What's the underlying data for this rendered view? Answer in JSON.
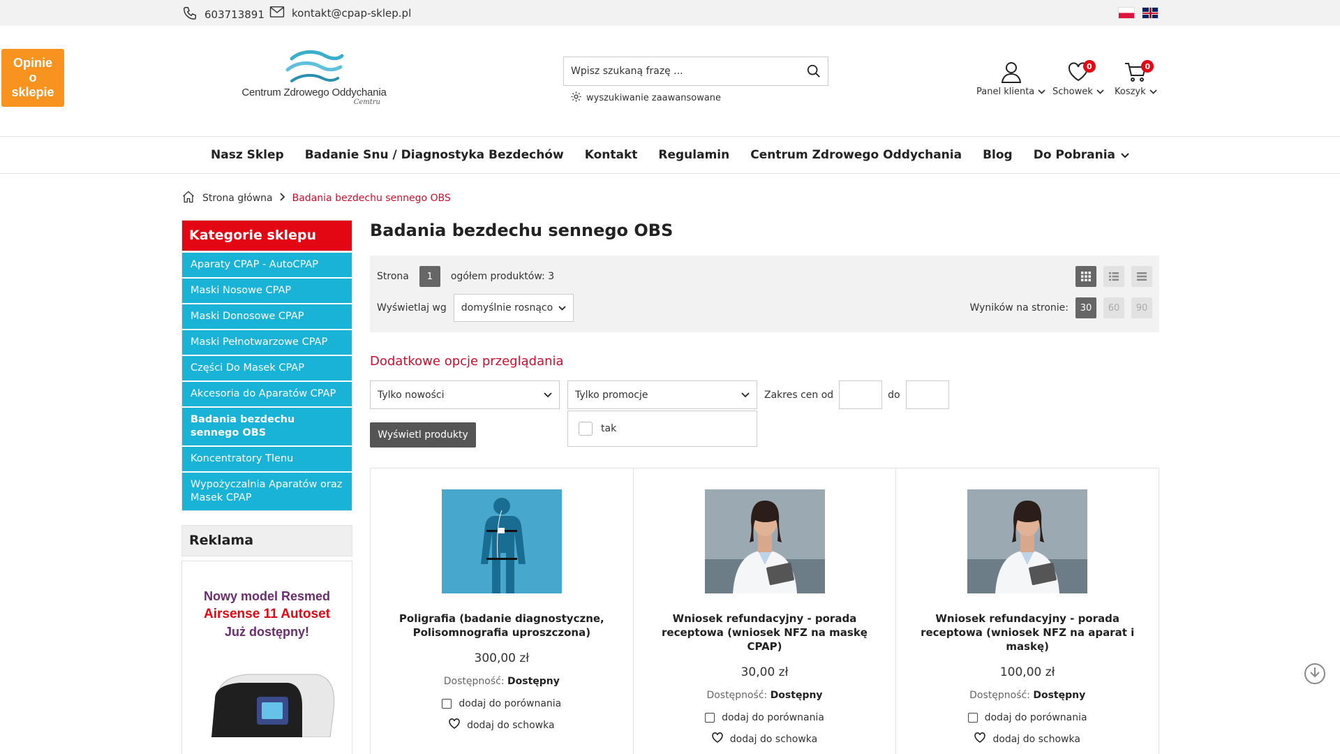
{
  "topbar": {
    "phone": "603713891",
    "email": "kontakt@cpap-sklep.pl",
    "languages": [
      "pl",
      "en"
    ]
  },
  "opinie": {
    "line1": "Opinie",
    "line2": "o",
    "line3": "sklepie"
  },
  "logo": {
    "text": "Centrum Zdrowego Oddychania",
    "sign": "Cemtru"
  },
  "search": {
    "placeholder": "Wpisz szukaną frazę ...",
    "advanced": "wyszukiwanie zaawansowane"
  },
  "account": {
    "panel": "Panel klienta",
    "wishlist": "Schowek",
    "wishlist_count": "0",
    "cart": "Koszyk",
    "cart_count": "0"
  },
  "nav": [
    "Nasz Sklep",
    "Badanie Snu / Diagnostyka Bezdechów",
    "Kontakt",
    "Regulamin",
    "Centrum Zdrowego Oddychania",
    "Blog",
    "Do Pobrania"
  ],
  "breadcrumb": {
    "home": "Strona główna",
    "current": "Badania bezdechu sennego OBS"
  },
  "sidebar": {
    "title": "Kategorie sklepu",
    "items": [
      "Aparaty CPAP - AutoCPAP",
      "Maski Nosowe CPAP",
      "Maski Donosowe CPAP",
      "Maski Pełnotwarzowe CPAP",
      "Części Do Masek CPAP",
      "Akcesoria do Aparatów CPAP",
      "Badania bezdechu sennego OBS",
      "Koncentratory Tlenu",
      "Wypożyczalnia Aparatów oraz Masek CPAP"
    ],
    "active_index": 6,
    "ad_title": "Reklama",
    "ad_line1": "Nowy model Resmed",
    "ad_line2": "Airsense 11 Autoset",
    "ad_line3": "Już dostępny!"
  },
  "main": {
    "title": "Badania bezdechu sennego OBS",
    "page_label": "Strona",
    "page_num": "1",
    "total": "ogółem produktów: 3",
    "sort_label": "Wyświetlaj wg",
    "sort_value": "domyślnie rosnąco",
    "per_page_label": "Wyników na stronie:",
    "per_page": [
      "30",
      "60",
      "90"
    ],
    "options_title": "Dodatkowe opcje przeglądania",
    "filter_new": "Tylko nowości",
    "filter_promo": "Tylko promocje",
    "promo_option": "tak",
    "range_from": "Zakres cen od",
    "range_to": "do",
    "show_button": "Wyświetl produkty"
  },
  "products": [
    {
      "name": "Poligrafia (badanie diagnostyczne, Polisomnografia uproszczona)",
      "price": "300,00 zł",
      "avail_label": "Dostępność:",
      "avail": "Dostępny",
      "compare": "dodaj do porównania",
      "wishlist": "dodaj do schowka",
      "image": "body-diagram"
    },
    {
      "name": "Wniosek refundacyjny - porada receptowa (wniosek NFZ na maskę CPAP)",
      "price": "30,00 zł",
      "avail_label": "Dostępność:",
      "avail": "Dostępny",
      "compare": "dodaj do porównania",
      "wishlist": "dodaj do schowka",
      "image": "doctor"
    },
    {
      "name": "Wniosek refundacyjny - porada receptowa (wniosek NFZ na aparat i maskę)",
      "price": "100,00 zł",
      "avail_label": "Dostępność:",
      "avail": "Dostępny",
      "compare": "dodaj do porównania",
      "wishlist": "dodaj do schowka",
      "image": "doctor"
    }
  ],
  "colors": {
    "accent": "#e30613",
    "sidebar": "#1ab3d8",
    "opinie": "#f7931e"
  }
}
